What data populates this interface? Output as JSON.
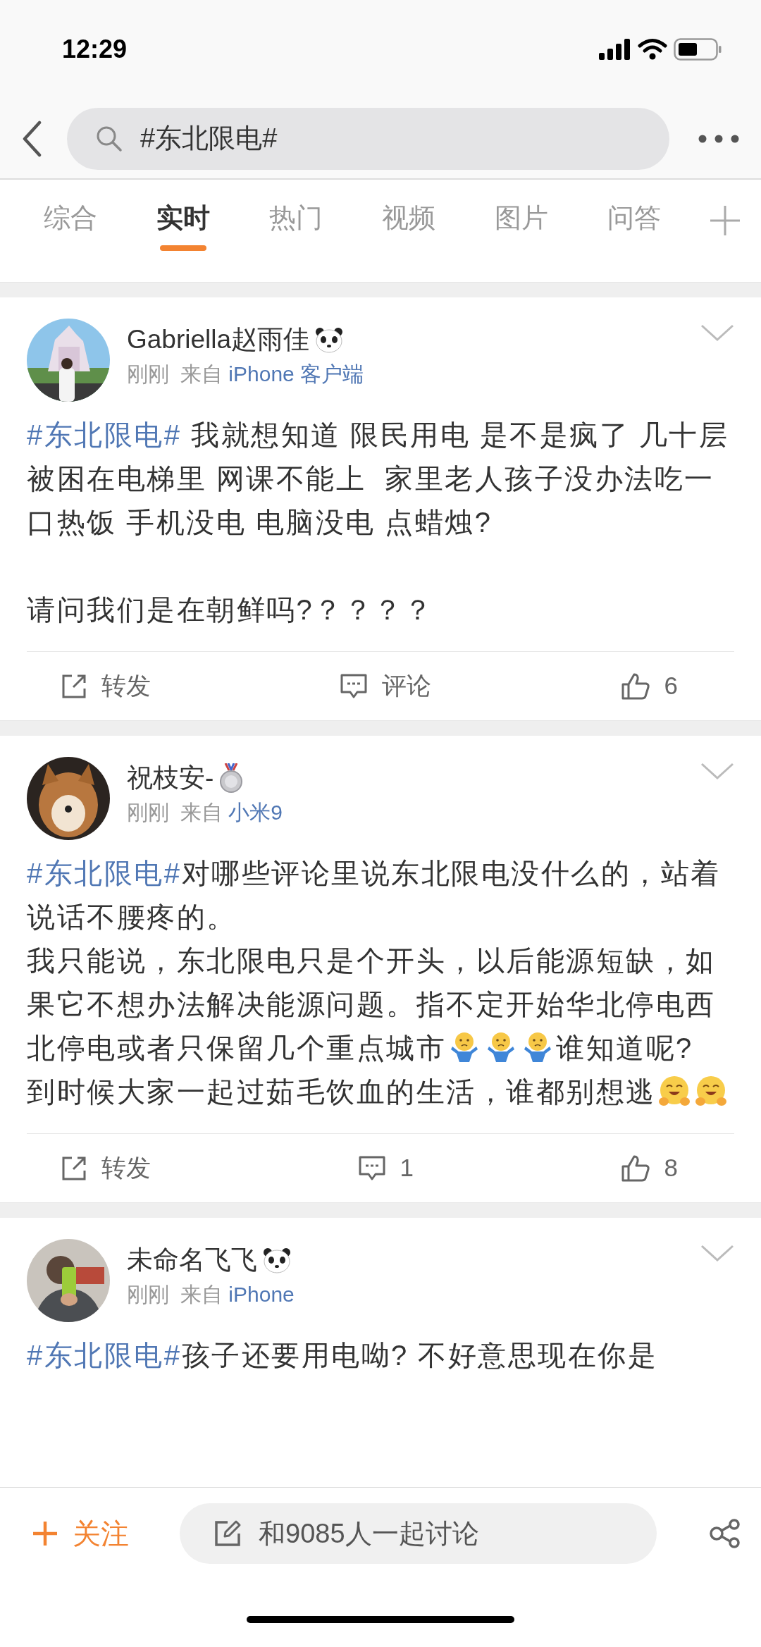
{
  "status_bar": {
    "time": "12:29"
  },
  "search": {
    "query": "#东北限电#"
  },
  "tabs": [
    {
      "label": "综合",
      "selected": false
    },
    {
      "label": "实时",
      "selected": true
    },
    {
      "label": "热门",
      "selected": false
    },
    {
      "label": "视频",
      "selected": false
    },
    {
      "label": "图片",
      "selected": false
    },
    {
      "label": "问答",
      "selected": false
    }
  ],
  "posts": [
    {
      "author": "Gabriella赵雨佳",
      "badge": {
        "kind": "panda"
      },
      "time": "刚刚",
      "source_prefix": "来自",
      "source": "iPhone 客户端",
      "paragraphs": [
        {
          "segments": [
            {
              "kind": "hashtag",
              "text": "#东北限电#"
            },
            {
              "kind": "text",
              "text": " 我就想知道 限民用电 是不是疯了 几十层被困在电梯里 网课不能上  家里老人孩子没办法吃一口热饭 手机没电 电脑没电 点蜡烛?\n\n请问我们是在朝鲜吗?？？？？"
            }
          ]
        }
      ],
      "actions": {
        "repost": "转发",
        "comment": "评论",
        "likes": "6"
      }
    },
    {
      "author": "祝枝安-",
      "badge": {
        "kind": "medal"
      },
      "time": "刚刚",
      "source_prefix": "来自",
      "source": "小米9",
      "paragraphs": [
        {
          "segments": [
            {
              "kind": "hashtag",
              "text": "#东北限电#"
            },
            {
              "kind": "text",
              "text": "对哪些评论里说东北限电没什么的，站着说话不腰疼的。"
            }
          ]
        },
        {
          "segments": [
            {
              "kind": "text",
              "text": "我只能说，东北限电只是个开头，以后能源短缺，如果它不想办法解决能源问题。指不定开始华北停电西北停电或者只保留几个重点城市"
            },
            {
              "kind": "shrug"
            },
            {
              "kind": "shrug"
            },
            {
              "kind": "shrug"
            },
            {
              "kind": "text",
              "text": "谁知道呢?"
            }
          ]
        },
        {
          "segments": [
            {
              "kind": "text",
              "text": "到时候大家一起过茹毛饮血的生活，谁都别想逃"
            },
            {
              "kind": "grin"
            },
            {
              "kind": "grin"
            }
          ]
        }
      ],
      "actions": {
        "repost": "转发",
        "comment": "1",
        "likes": "8"
      }
    },
    {
      "author": "未命名飞飞",
      "badge": {
        "kind": "panda"
      },
      "time": "刚刚",
      "source_prefix": "来自",
      "source": "iPhone",
      "paragraphs": [
        {
          "segments": [
            {
              "kind": "hashtag",
              "text": "#东北限电#"
            },
            {
              "kind": "text",
              "text": "孩子还要用电呦? 不好意思现在你是"
            }
          ]
        }
      ]
    }
  ],
  "bottom_bar": {
    "follow": "关注",
    "comment_placeholder": "和9085人一起讨论"
  }
}
